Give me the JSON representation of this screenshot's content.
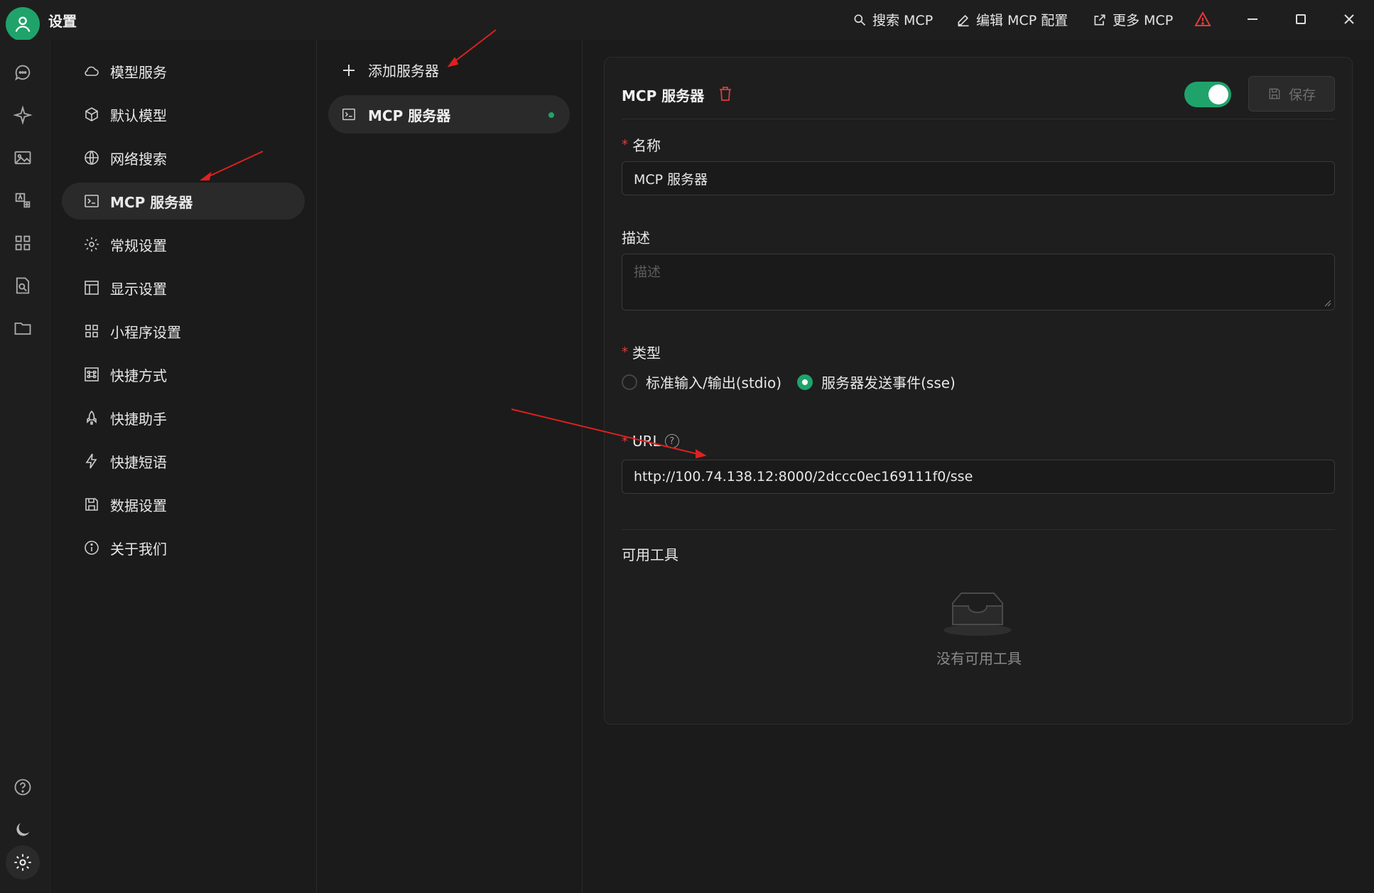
{
  "window": {
    "title": "设置",
    "actions": [
      {
        "label": "搜索 MCP",
        "icon": "search-icon"
      },
      {
        "label": "编辑 MCP 配置",
        "icon": "edit-icon"
      },
      {
        "label": "更多 MCP",
        "icon": "external-link-icon"
      }
    ],
    "warning_color": "#e23b3b"
  },
  "rail": {
    "icons": [
      "chat-icon",
      "sparkle-icon",
      "image-icon",
      "translate-icon",
      "apps-icon",
      "file-search-icon",
      "folder-icon",
      "help-icon",
      "moon-icon",
      "gear-icon"
    ]
  },
  "settings_nav": {
    "items": [
      {
        "label": "模型服务",
        "icon": "cloud-icon"
      },
      {
        "label": "默认模型",
        "icon": "cube-icon"
      },
      {
        "label": "网络搜索",
        "icon": "globe-icon"
      },
      {
        "label": "MCP 服务器",
        "icon": "terminal-icon",
        "active": true
      },
      {
        "label": "常规设置",
        "icon": "gear-icon"
      },
      {
        "label": "显示设置",
        "icon": "layout-icon"
      },
      {
        "label": "小程序设置",
        "icon": "grid-icon"
      },
      {
        "label": "快捷方式",
        "icon": "command-icon"
      },
      {
        "label": "快捷助手",
        "icon": "rocket-icon"
      },
      {
        "label": "快捷短语",
        "icon": "zap-icon"
      },
      {
        "label": "数据设置",
        "icon": "save-icon"
      },
      {
        "label": "关于我们",
        "icon": "info-icon"
      }
    ]
  },
  "servers": {
    "add_label": "添加服务器",
    "list": [
      {
        "name": "MCP 服务器",
        "status": "active"
      }
    ]
  },
  "detail": {
    "title": "MCP 服务器",
    "enabled": true,
    "save_label": "保存",
    "name_label": "名称",
    "name_value": "MCP 服务器",
    "desc_label": "描述",
    "desc_placeholder": "描述",
    "type_label": "类型",
    "type_options": [
      {
        "label": "标准输入/输出(stdio)",
        "selected": false
      },
      {
        "label": "服务器发送事件(sse)",
        "selected": true
      }
    ],
    "url_label": "URL",
    "url_value": "http://100.74.138.12:8000/2dccc0ec169111f0/sse",
    "tools_label": "可用工具",
    "tools_empty": "没有可用工具"
  },
  "colors": {
    "accent": "#1fa36b",
    "required": "#e23b3b",
    "annotation": "#e02020"
  }
}
